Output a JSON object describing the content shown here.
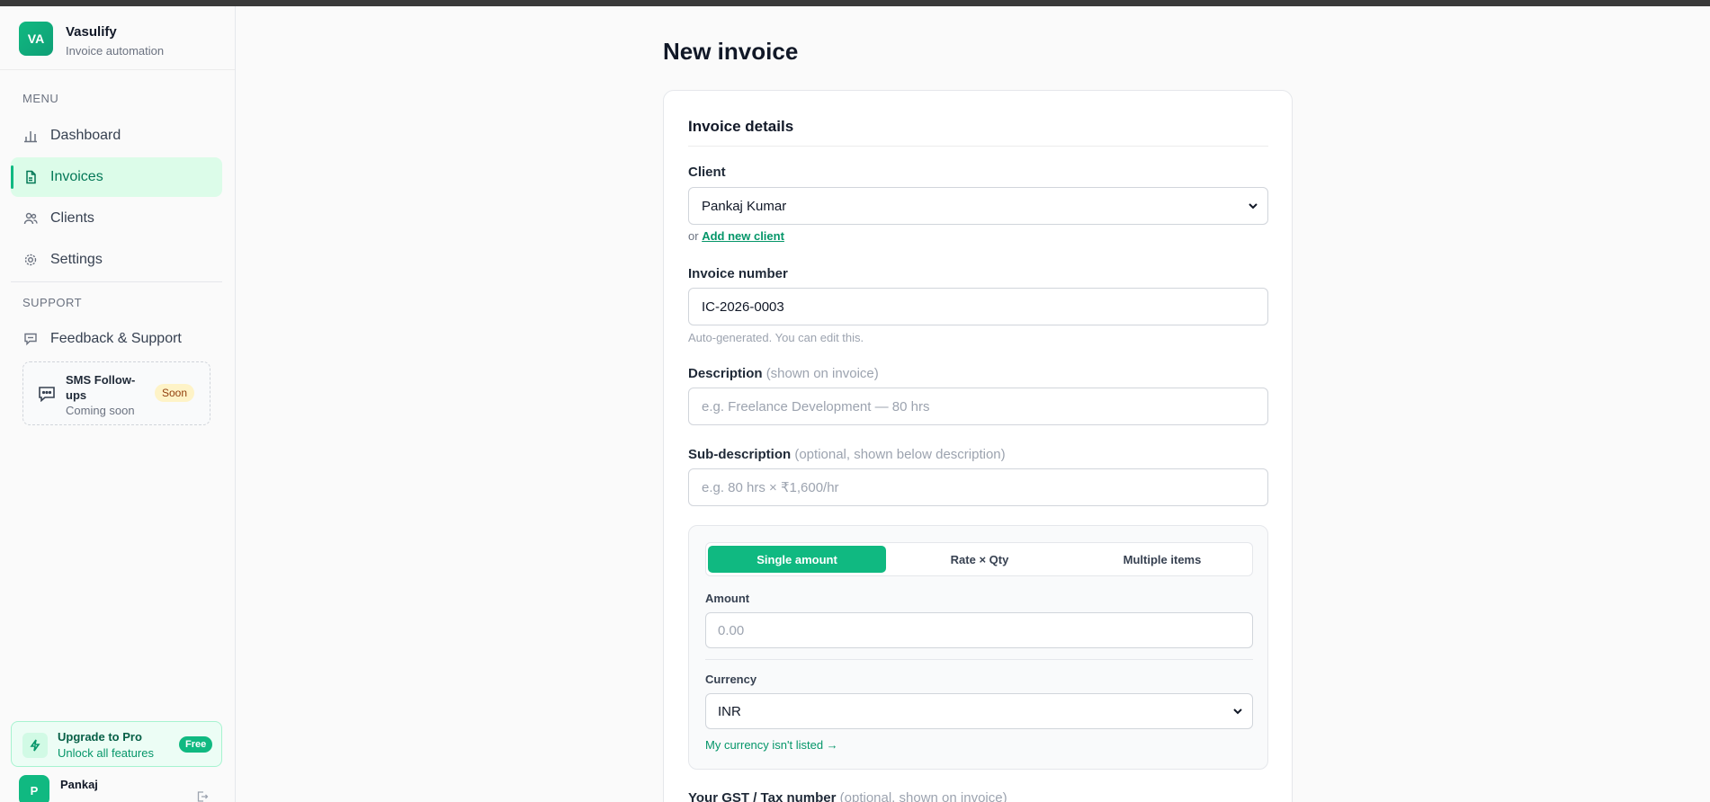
{
  "brand": {
    "initials": "VA",
    "name": "Vasulify",
    "tagline": "Invoice automation"
  },
  "sidebar": {
    "menu_label": "MENU",
    "items": [
      {
        "label": "Dashboard",
        "icon": "bar-chart-icon"
      },
      {
        "label": "Invoices",
        "icon": "document-icon",
        "active": true
      },
      {
        "label": "Clients",
        "icon": "users-icon"
      },
      {
        "label": "Settings",
        "icon": "gear-icon"
      }
    ],
    "support_label": "SUPPORT",
    "support_items": [
      {
        "label": "Feedback & Support",
        "icon": "chat-icon"
      }
    ],
    "sms_card": {
      "title": "SMS Follow-ups",
      "subtitle": "Coming soon",
      "badge": "Soon"
    },
    "upgrade": {
      "title": "Upgrade to Pro",
      "subtitle": "Unlock all features",
      "badge": "Free"
    },
    "user": {
      "initial": "P",
      "name": "Pankaj"
    }
  },
  "page": {
    "title": "New invoice"
  },
  "form": {
    "section_title": "Invoice details",
    "client": {
      "label": "Client",
      "value": "Pankaj Kumar",
      "help_prefix": "or",
      "add_link": "Add new client"
    },
    "invoice_number": {
      "label": "Invoice number",
      "value": "IC-2026-0003",
      "help": "Auto-generated. You can edit this."
    },
    "description": {
      "label": "Description",
      "hint": "(shown on invoice)",
      "placeholder": "e.g. Freelance Development — 80 hrs"
    },
    "sub_description": {
      "label": "Sub-description",
      "hint": "(optional, shown below description)",
      "placeholder": "e.g. 80 hrs × ₹1,600/hr"
    },
    "mode_tabs": [
      "Single amount",
      "Rate × Qty",
      "Multiple items"
    ],
    "active_mode": "Single amount",
    "amount": {
      "label": "Amount",
      "placeholder": "0.00"
    },
    "currency": {
      "label": "Currency",
      "value": "INR",
      "link": "My currency isn't listed →"
    },
    "tax": {
      "label": "Your GST / Tax number",
      "hint": "(optional, shown on invoice)"
    }
  },
  "colors": {
    "accent": "#10b981",
    "accent_dark": "#047857",
    "active_bg": "#dcfce9"
  }
}
